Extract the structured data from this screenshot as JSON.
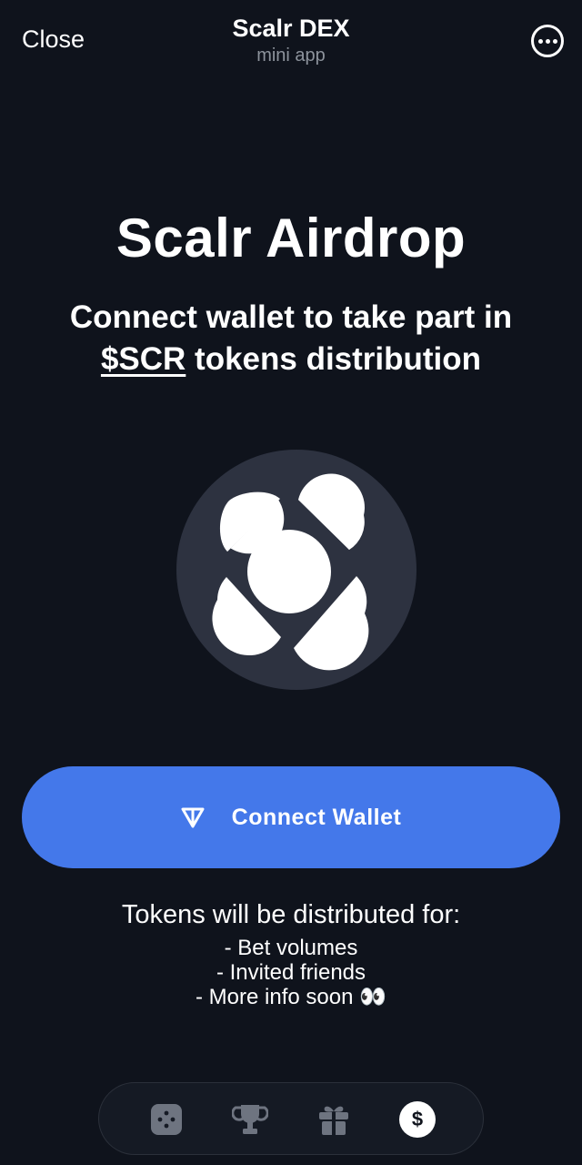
{
  "header": {
    "close_label": "Close",
    "title": "Scalr DEX",
    "subtitle": "mini app",
    "more_icon": "more-horizontal-circle-icon"
  },
  "hero": {
    "title": "Scalr Airdrop",
    "subtitle_line1": "Connect wallet to take part in",
    "subtitle_ticker": "$SCR",
    "subtitle_line2_rest": " tokens distribution"
  },
  "logo": {
    "icon": "scalr-logo-icon",
    "background": "#2d3240"
  },
  "connect": {
    "label": "Connect Wallet",
    "icon": "ton-icon",
    "color": "#4478ea"
  },
  "info": {
    "title": "Tokens will be distributed for:",
    "items": [
      "- Bet volumes",
      "- Invited friends",
      "- More info soon 👀"
    ]
  },
  "nav": {
    "items": [
      {
        "name": "dice",
        "icon": "dice-icon",
        "active": false
      },
      {
        "name": "leaderboard",
        "icon": "trophy-icon",
        "active": false
      },
      {
        "name": "rewards",
        "icon": "gift-icon",
        "active": false
      },
      {
        "name": "airdrop",
        "icon": "dollar-icon",
        "glyph": "$",
        "active": true
      }
    ]
  },
  "colors": {
    "background": "#0f131c",
    "accent": "#4478ea",
    "muted_text": "#8d939c"
  }
}
